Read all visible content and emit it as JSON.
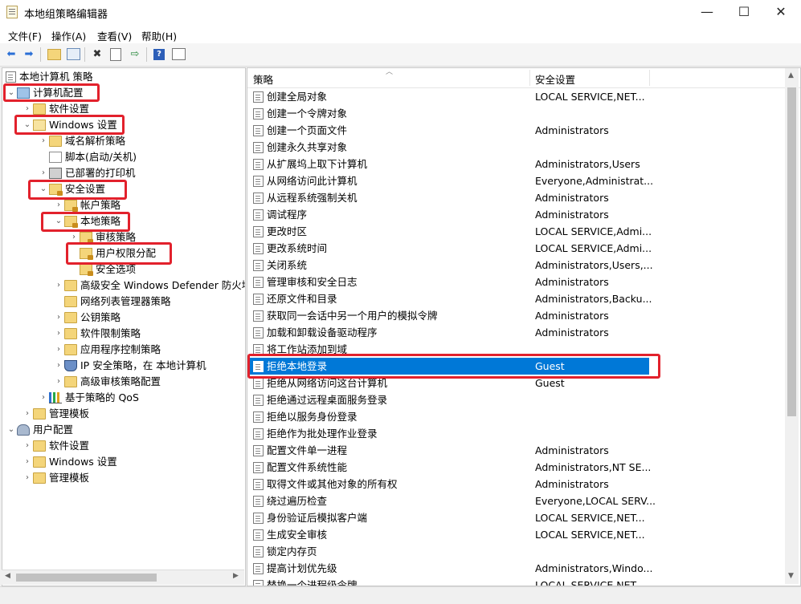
{
  "window": {
    "title": "本地组策略编辑器",
    "minimize": "—",
    "maximize": "☐",
    "close": "✕"
  },
  "menu": [
    "文件(F)",
    "操作(A)",
    "查看(V)",
    "帮助(H)"
  ],
  "toolbar": [
    "back-icon",
    "forward-icon",
    "up-folder-icon",
    "show-hide-tree-icon",
    "delete-icon",
    "properties-icon",
    "export-icon",
    "help-icon",
    "view-icon"
  ],
  "tree": {
    "root": "本地计算机 策略",
    "items": [
      {
        "label": "计算机配置",
        "level": 0,
        "exp": "⌄",
        "icon": "computer"
      },
      {
        "label": "软件设置",
        "level": 1,
        "exp": "›",
        "icon": "folder"
      },
      {
        "label": "Windows 设置",
        "level": 1,
        "exp": "⌄",
        "icon": "folder-open"
      },
      {
        "label": "域名解析策略",
        "level": 2,
        "exp": "›",
        "icon": "folder"
      },
      {
        "label": "脚本(启动/关机)",
        "level": 2,
        "exp": "",
        "icon": "doc"
      },
      {
        "label": "已部署的打印机",
        "level": 2,
        "exp": "›",
        "icon": "printer"
      },
      {
        "label": "安全设置",
        "level": 2,
        "exp": "⌄",
        "icon": "lockfolder"
      },
      {
        "label": "帐户策略",
        "level": 3,
        "exp": "›",
        "icon": "lockfolder"
      },
      {
        "label": "本地策略",
        "level": 3,
        "exp": "⌄",
        "icon": "lockfolder"
      },
      {
        "label": "审核策略",
        "level": 4,
        "exp": "›",
        "icon": "lockfolder"
      },
      {
        "label": "用户权限分配",
        "level": 4,
        "exp": "",
        "icon": "lockfolder"
      },
      {
        "label": "安全选项",
        "level": 4,
        "exp": "",
        "icon": "lockfolder"
      },
      {
        "label": "高级安全 Windows Defender 防火墙",
        "level": 3,
        "exp": "›",
        "icon": "folder"
      },
      {
        "label": "网络列表管理器策略",
        "level": 3,
        "exp": "",
        "icon": "folder"
      },
      {
        "label": "公钥策略",
        "level": 3,
        "exp": "›",
        "icon": "folder"
      },
      {
        "label": "软件限制策略",
        "level": 3,
        "exp": "›",
        "icon": "folder"
      },
      {
        "label": "应用程序控制策略",
        "level": 3,
        "exp": "›",
        "icon": "folder"
      },
      {
        "label": "IP 安全策略，在 本地计算机",
        "level": 3,
        "exp": "›",
        "icon": "shield"
      },
      {
        "label": "高级审核策略配置",
        "level": 3,
        "exp": "›",
        "icon": "folder"
      },
      {
        "label": "基于策略的 QoS",
        "level": 2,
        "exp": "›",
        "icon": "chart"
      },
      {
        "label": "管理模板",
        "level": 1,
        "exp": "›",
        "icon": "folder"
      },
      {
        "label": "用户配置",
        "level": 0,
        "exp": "⌄",
        "icon": "users"
      },
      {
        "label": "软件设置",
        "level": 1,
        "exp": "›",
        "icon": "folder"
      },
      {
        "label": "Windows 设置",
        "level": 1,
        "exp": "›",
        "icon": "folder"
      },
      {
        "label": "管理模板",
        "level": 1,
        "exp": "›",
        "icon": "folder"
      }
    ]
  },
  "list": {
    "columns": [
      "策略",
      "安全设置"
    ],
    "selected_index": 16,
    "rows": [
      {
        "policy": "创建全局对象",
        "setting": "LOCAL SERVICE,NET..."
      },
      {
        "policy": "创建一个令牌对象",
        "setting": ""
      },
      {
        "policy": "创建一个页面文件",
        "setting": "Administrators"
      },
      {
        "policy": "创建永久共享对象",
        "setting": ""
      },
      {
        "policy": "从扩展坞上取下计算机",
        "setting": "Administrators,Users"
      },
      {
        "policy": "从网络访问此计算机",
        "setting": "Everyone,Administrat..."
      },
      {
        "policy": "从远程系统强制关机",
        "setting": "Administrators"
      },
      {
        "policy": "调试程序",
        "setting": "Administrators"
      },
      {
        "policy": "更改时区",
        "setting": "LOCAL SERVICE,Admi..."
      },
      {
        "policy": "更改系统时间",
        "setting": "LOCAL SERVICE,Admi..."
      },
      {
        "policy": "关闭系统",
        "setting": "Administrators,Users,..."
      },
      {
        "policy": "管理审核和安全日志",
        "setting": "Administrators"
      },
      {
        "policy": "还原文件和目录",
        "setting": "Administrators,Backu..."
      },
      {
        "policy": "获取同一会话中另一个用户的模拟令牌",
        "setting": "Administrators"
      },
      {
        "policy": "加载和卸载设备驱动程序",
        "setting": "Administrators"
      },
      {
        "policy": "将工作站添加到域",
        "setting": ""
      },
      {
        "policy": "拒绝本地登录",
        "setting": "Guest"
      },
      {
        "policy": "拒绝从网络访问这台计算机",
        "setting": "Guest"
      },
      {
        "policy": "拒绝通过远程桌面服务登录",
        "setting": ""
      },
      {
        "policy": "拒绝以服务身份登录",
        "setting": ""
      },
      {
        "policy": "拒绝作为批处理作业登录",
        "setting": ""
      },
      {
        "policy": "配置文件单一进程",
        "setting": "Administrators"
      },
      {
        "policy": "配置文件系统性能",
        "setting": "Administrators,NT SE..."
      },
      {
        "policy": "取得文件或其他对象的所有权",
        "setting": "Administrators"
      },
      {
        "policy": "绕过遍历检查",
        "setting": "Everyone,LOCAL SERV..."
      },
      {
        "policy": "身份验证后模拟客户端",
        "setting": "LOCAL SERVICE,NET..."
      },
      {
        "policy": "生成安全审核",
        "setting": "LOCAL SERVICE,NET..."
      },
      {
        "policy": "锁定内存页",
        "setting": ""
      },
      {
        "policy": "提高计划优先级",
        "setting": "Administrators,Windo..."
      },
      {
        "policy": "替换一个进程级令牌",
        "setting": "LOCAL SERVICE,NET..."
      }
    ]
  }
}
